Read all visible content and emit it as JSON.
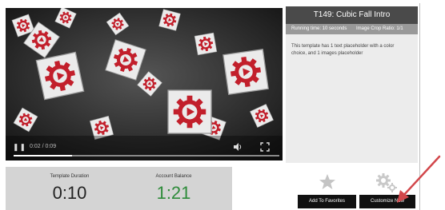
{
  "player": {
    "play_pause_glyph": "❚❚",
    "time_label": "0:02 / 0:09",
    "volume_icon": "volume-icon",
    "fullscreen_icon": "fullscreen-icon",
    "progress": 0.22
  },
  "template": {
    "title": "T149: Cubic Fall Intro",
    "running_time": "Running time: 10 seconds",
    "crop_ratio": "Image Crop Ratio: 1/1",
    "description": "This template has 1 text placeholder with a color choice, and 1 images placeholder"
  },
  "stats": {
    "duration_label": "Template Duration",
    "duration_value": "0:10",
    "balance_label": "Account Balance",
    "balance_value": "1:21"
  },
  "actions": {
    "favorites_label": "Add To Favorites",
    "customize_label": "Customize Now",
    "favorite_icon": "star-icon",
    "settings_icon": "gears-icon"
  },
  "colors": {
    "brand_red": "#c21f2b",
    "balance_green": "#2e8b3a",
    "annotation_arrow": "#d2474b"
  }
}
